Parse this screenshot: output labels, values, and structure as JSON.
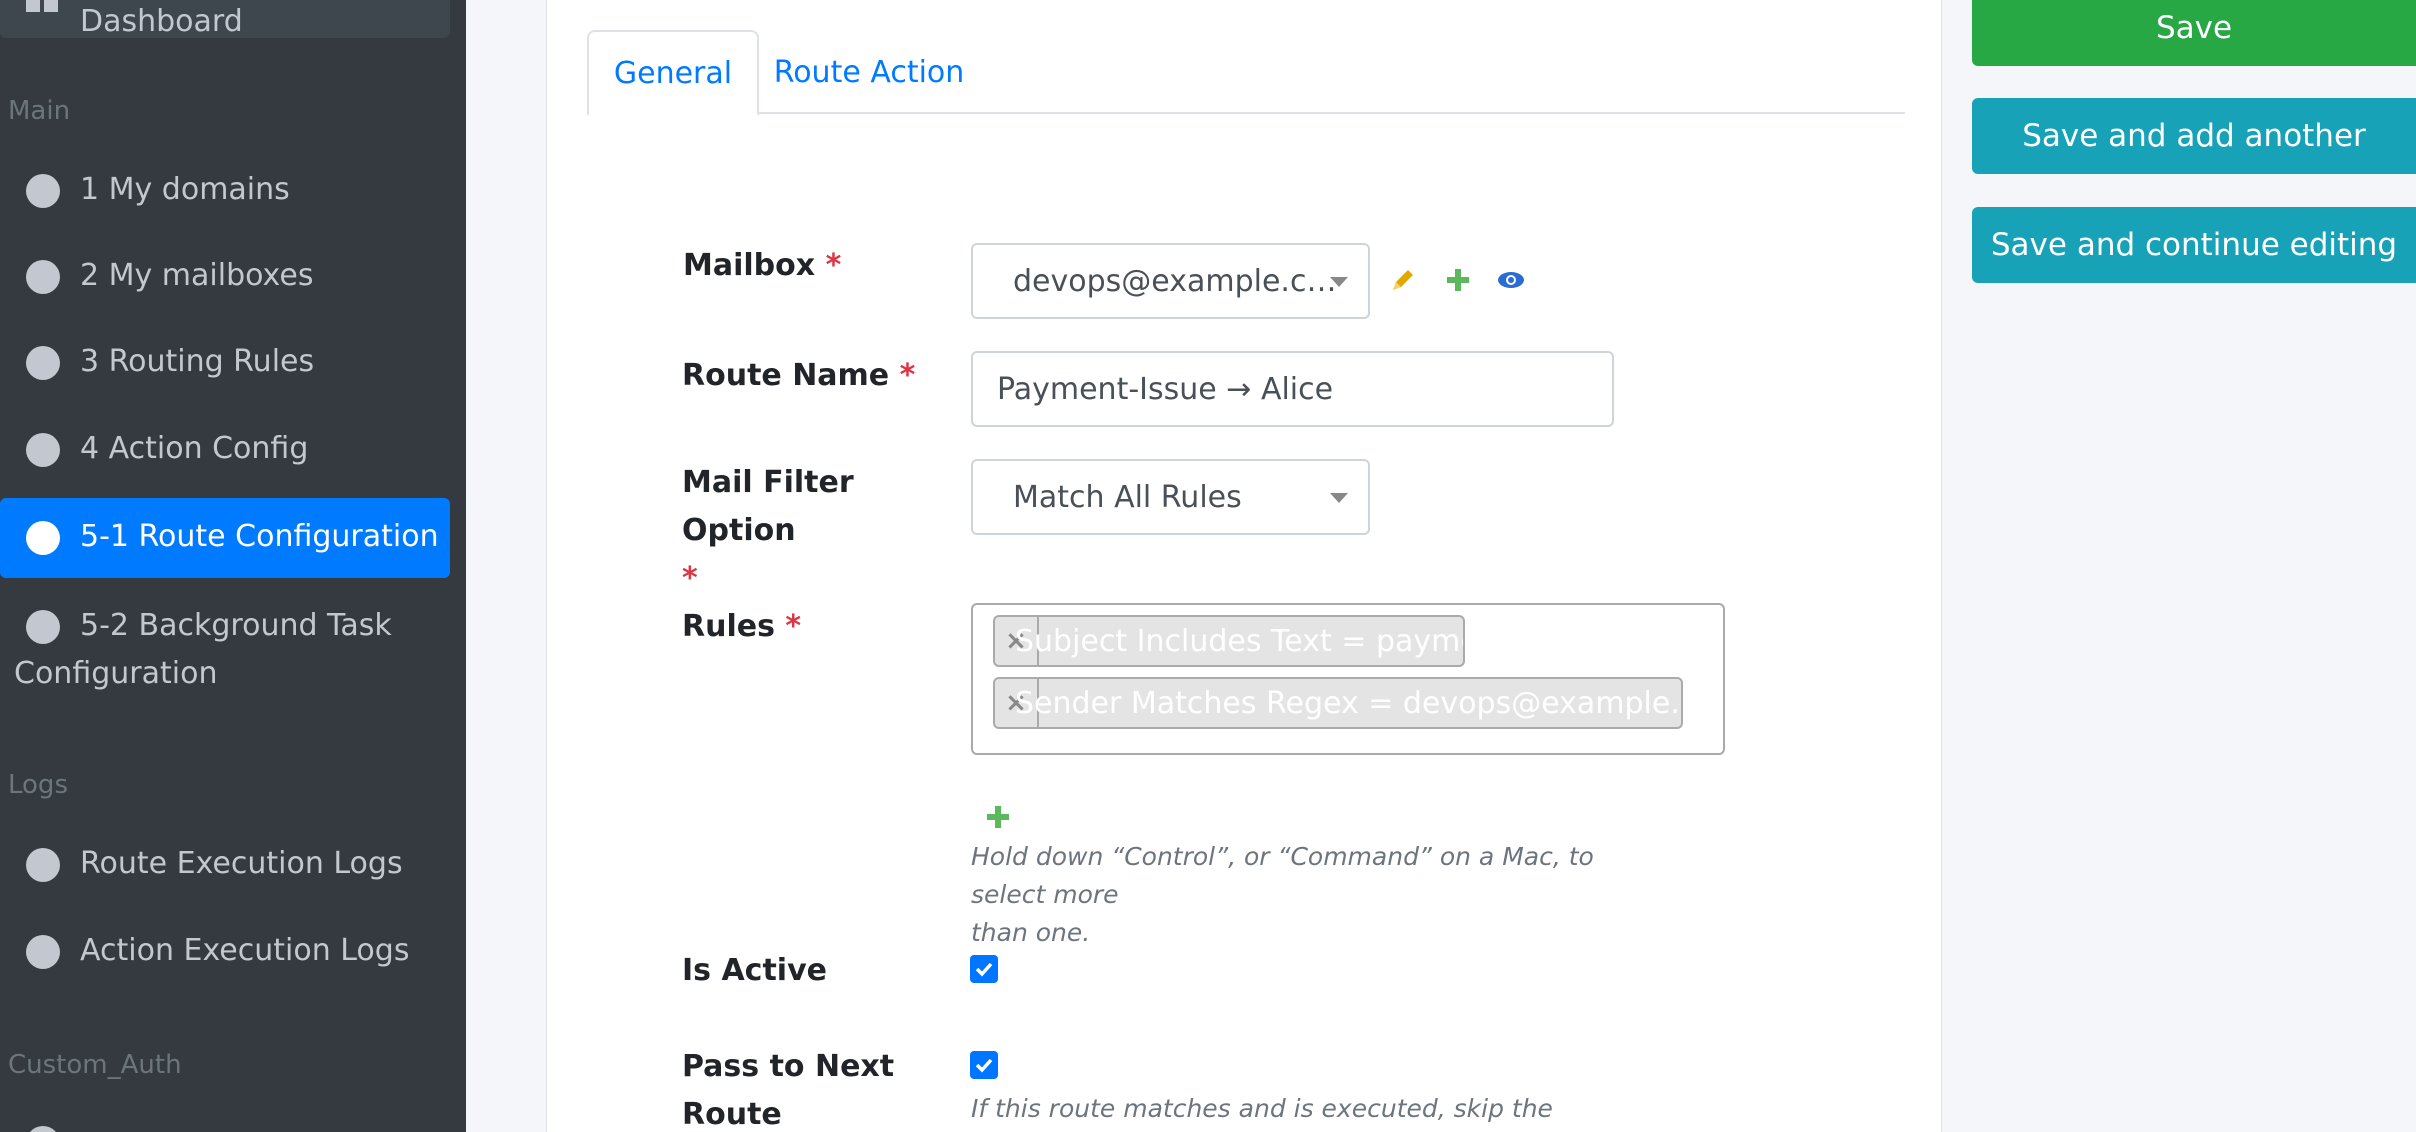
{
  "sidebar": {
    "dashboard_label": "Dashboard",
    "sections": {
      "main": "Main",
      "logs": "Logs",
      "custom_auth": "Custom_Auth"
    },
    "items": [
      {
        "label": "1 My domains"
      },
      {
        "label": "2 My mailboxes"
      },
      {
        "label": "3 Routing Rules"
      },
      {
        "label": "4 Action Config"
      },
      {
        "label": "5-1 Route Configuration"
      },
      {
        "label_line1": "5-2 Background Task",
        "label_line2": "Configuration"
      },
      {
        "label": "Route Execution Logs"
      },
      {
        "label": "Action Execution Logs"
      }
    ]
  },
  "tabs": [
    {
      "label": "General"
    },
    {
      "label": "Route Action"
    }
  ],
  "form": {
    "required_marker": "*",
    "mailbox": {
      "label": "Mailbox",
      "value": "devops@example.c…"
    },
    "route_name": {
      "label": "Route Name",
      "value": "Payment-Issue → Alice"
    },
    "mail_filter": {
      "label": "Mail Filter Option",
      "value": "Match All Rules"
    },
    "rules": {
      "label": "Rules",
      "chips": [
        {
          "text": "Subject Includes Text = payment"
        },
        {
          "text": "Sender Matches Regex = devops@example.com"
        }
      ],
      "remove_glyph": "×",
      "help_line1": "Hold down “Control”, or “Command” on a Mac, to select more",
      "help_line2": "than one."
    },
    "is_active": {
      "label": "Is Active",
      "checked": true
    },
    "pass_to_next": {
      "label_line1": "Pass to Next",
      "label_line2": "Route",
      "checked": true,
      "help": "If this route matches and is executed, skip the following"
    }
  },
  "actions": {
    "save": "Save",
    "save_add": "Save and add another",
    "save_continue": "Save and continue editing"
  },
  "colors": {
    "primary": "#007bff",
    "success": "#28a745",
    "info": "#17a2b8",
    "danger": "#dc3545",
    "sidebar_bg": "#343a40"
  }
}
